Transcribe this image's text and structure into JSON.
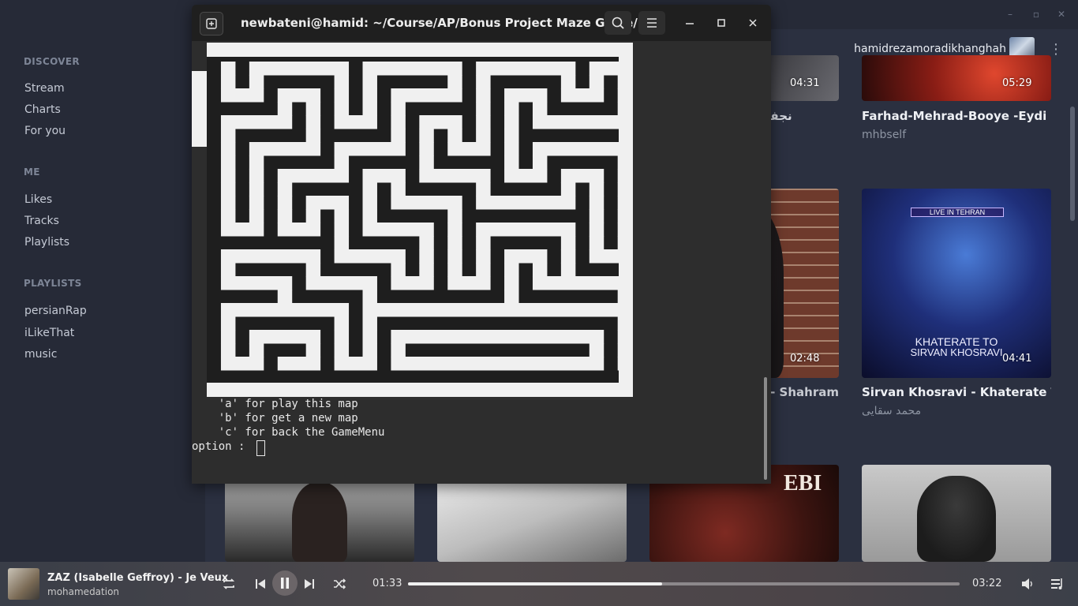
{
  "app": {
    "window_controls": {
      "minimize": "–",
      "restore": "▫",
      "close": "✕"
    }
  },
  "sidebar": {
    "sections": [
      {
        "title": "DISCOVER",
        "items": [
          "Stream",
          "Charts",
          "For you"
        ]
      },
      {
        "title": "ME",
        "items": [
          "Likes",
          "Tracks",
          "Playlists"
        ]
      },
      {
        "title": "PLAYLISTS",
        "items": [
          "persianRap",
          "iLikeThat",
          "music"
        ]
      }
    ]
  },
  "header": {
    "username": "hamidrezamoradikhanghah"
  },
  "cards": [
    {
      "duration": "04:31",
      "title": "نجفی shahin najafi ین",
      "subtitle": ""
    },
    {
      "duration": "05:29",
      "title": "Farhad-Mehrad-Booye -Eydi",
      "subtitle": "mhbself"
    },
    {
      "duration": "02:48",
      "title": "Sogand - Shahram - شخ رسوگند",
      "subtitle": ""
    },
    {
      "duration": "04:41",
      "title": "Sirvan Khosravi - Khaterate To - Liv",
      "subtitle": "محمد سقایی",
      "art_top": "LIVE IN TEHRAN",
      "art_line1": "KHATERATE TO",
      "art_line2": "SIRVAN KHOSRAVI"
    },
    {
      "duration": "",
      "title": "",
      "subtitle": "",
      "art_text": "EBI"
    }
  ],
  "player": {
    "track_title": "ZAZ (Isabelle Geffroy) - Je Veux",
    "artist": "mohamedation",
    "current_time": "01:33",
    "total_time": "03:22",
    "progress": 0.46
  },
  "terminal": {
    "title": "newbateni@hamid: ~/Course/AP/Bonus Project Maze Game/...",
    "lines": [
      "    'a' for play this map",
      "    'b' for get a new map",
      "    'c' for back the GameMenu",
      "option : "
    ],
    "maze_rows": [
      "###############################",
      "#.#.......#.......#.......#...#",
      "#.#.#####.#.#####.#.#####.#.#.#",
      "#...#...#.#.#.....#.#...#...#.#",
      "#####.#.#.#.#.#####.#.#.#####.#",
      "#.....#.#...#.#...#.#.#.......#",
      "#.#####.#####.#.#.#.#.#########",
      "#.#.....#.....#.#...#.#.......#",
      "#.#.#####.#####.#####.#.#####.#",
      "#.#.#.....#...#.....#...#...#.#",
      "#.#.#.#####.#.#####.#####.#.#.#",
      "#.#.#.#...#.#.....#.......#.#.#",
      "#.#.#.#.#.#.#####.#########.#.#",
      "#...#...#.#.....#.#.......#.#.#",
      "#########.#####.#.#.#####.#.#.#",
      "#.......#.....#.#.#.#...#.#...#",
      "#.#####.#####.#.#.#.#.#.#.#####",
      "#.....#.....#...#...#.#.......#",
      "#####.#####.#########.#######.#",
      "#.........#...................#",
      "#.#######.#.#################.#",
      "#.#.....#.#.#...............#.#",
      "#.#.###.#.#.#.#############.#.#",
      "#...#...#...#...............#.#",
      "###############################"
    ]
  }
}
